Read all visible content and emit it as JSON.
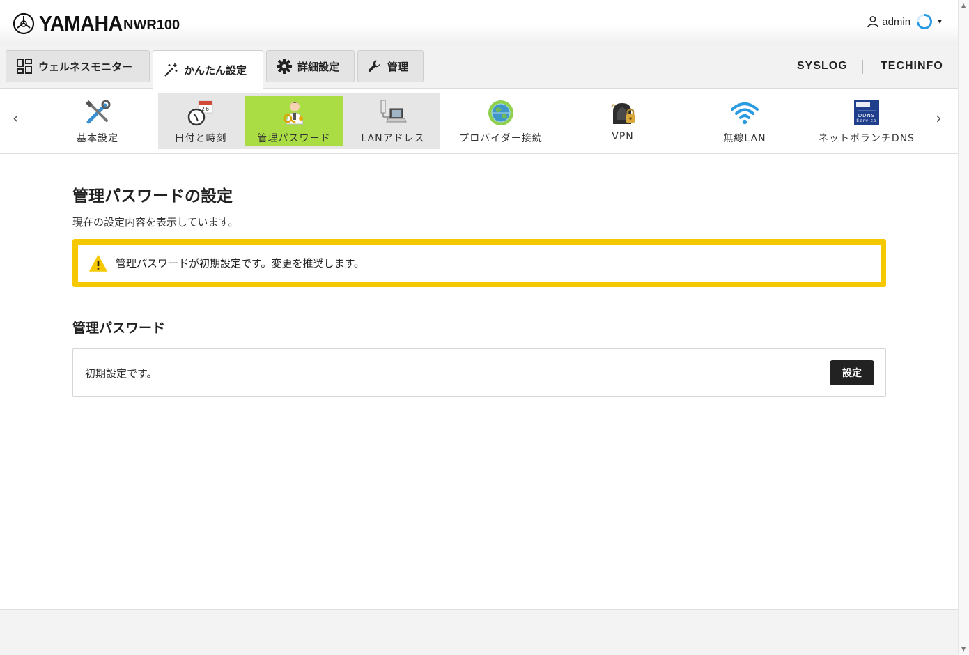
{
  "header": {
    "brand": "YAMAHA",
    "model": "NWR100",
    "user": "admin"
  },
  "main_tabs": [
    {
      "label": "ウェルネスモニター",
      "icon": "dashboard-icon"
    },
    {
      "label": "かんたん設定",
      "icon": "magic-wand-icon",
      "active": true
    },
    {
      "label": "詳細設定",
      "icon": "gear-icon"
    },
    {
      "label": "管理",
      "icon": "wrench-icon"
    }
  ],
  "top_links": [
    "SYSLOG",
    "TECHINFO"
  ],
  "sub_items": [
    {
      "label": "基本設定",
      "icon": "tools-icon"
    },
    {
      "label": "日付と時刻",
      "icon": "calendar-clock-icon"
    },
    {
      "label": "管理パスワード",
      "icon": "admin-person-key-icon",
      "active": true
    },
    {
      "label": "LANアドレス",
      "icon": "lan-laptop-icon"
    },
    {
      "label": "プロバイダー接続",
      "icon": "globe-icon"
    },
    {
      "label": "VPN",
      "icon": "vpn-lock-icon"
    },
    {
      "label": "無線LAN",
      "icon": "wifi-icon"
    },
    {
      "label": "ネットボランチDNS",
      "icon": "ddns-service-icon"
    }
  ],
  "ddns_icon_text": {
    "line1": "DDNS",
    "line2": "Service"
  },
  "page": {
    "title": "管理パスワードの設定",
    "description": "現在の設定内容を表示しています。",
    "alert": "管理パスワードが初期設定です。変更を推奨します。",
    "section_title": "管理パスワード",
    "status": "初期設定です。",
    "set_button": "設定"
  },
  "colors": {
    "alert_border": "#f5c800",
    "active_sub": "#aadd44",
    "button": "#222222",
    "loading_ring": "#2a9be0"
  }
}
